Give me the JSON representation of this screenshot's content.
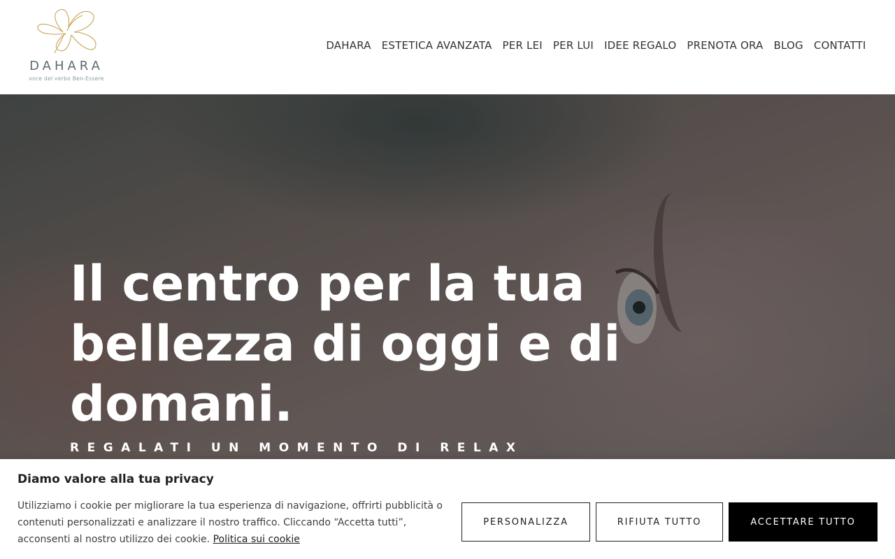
{
  "header": {
    "logo_word": "DAHARA",
    "logo_tagline": "voce del verbo Ben-Essere",
    "nav": [
      {
        "label": "DAHARA"
      },
      {
        "label": "ESTETICA AVANZATA"
      },
      {
        "label": "PER LEI"
      },
      {
        "label": "PER LUI"
      },
      {
        "label": "IDEE REGALO"
      },
      {
        "label": "PRENOTA ORA"
      },
      {
        "label": "BLOG"
      },
      {
        "label": "CONTATTI"
      }
    ]
  },
  "hero": {
    "title_line1": "Il centro per la tua",
    "title_line2": "bellezza di oggi e di",
    "title_line3": "domani.",
    "subtitle": "REGALATI UN MOMENTO DI RELAX"
  },
  "cookie_banner": {
    "title": "Diamo valore alla tua privacy",
    "text": "Utilizziamo i cookie per migliorare la tua esperienza di navigazione, offrirti pubblicità o contenuti personalizzati e analizzare il nostro traffico. Cliccando “Accetta tutti”, acconsenti al nostro utilizzo dei cookie. ",
    "policy_link": "Politica sui cookie",
    "customize_label": "PERSONALIZZA",
    "reject_label": "RIFIUTA TUTTO",
    "accept_label": "ACCETTARE TUTTO"
  },
  "colors": {
    "logo_gold": "#c9a55a",
    "logo_text": "#5d6b70",
    "accept_button_bg": "#000000"
  },
  "icons": {
    "logo_mark": "flower-outline-icon"
  }
}
